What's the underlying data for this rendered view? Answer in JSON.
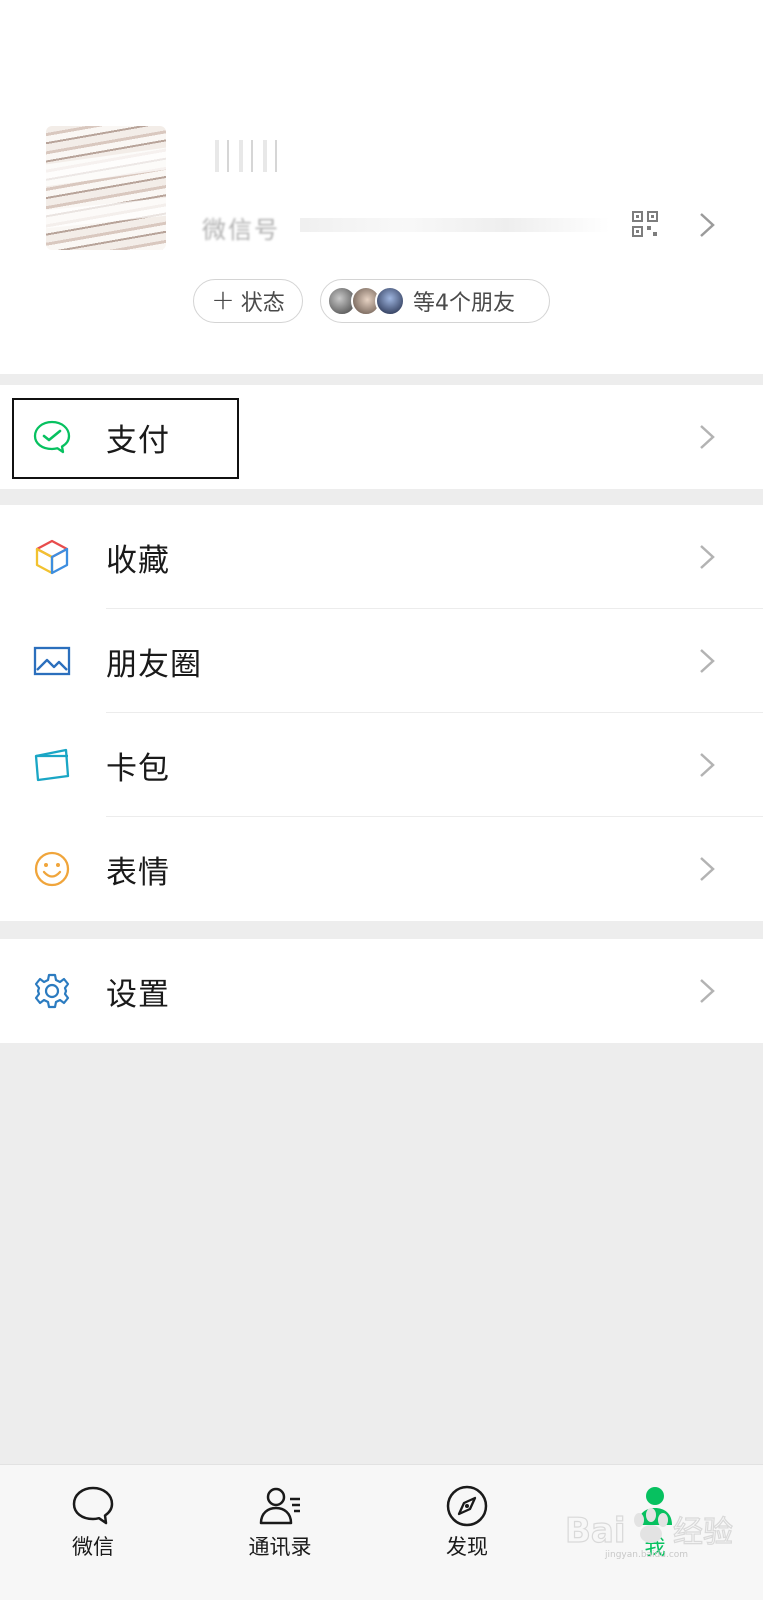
{
  "profile": {
    "wechat_id_label": "微信号",
    "status_label": "状态",
    "status_plus": "+",
    "friends_label": "等4个朋友"
  },
  "menu": {
    "pay": "支付",
    "favorites": "收藏",
    "moments": "朋友圈",
    "cards": "卡包",
    "stickers": "表情",
    "settings": "设置"
  },
  "tabbar": {
    "chats": "微信",
    "contacts": "通讯录",
    "discover": "发现",
    "me": "我"
  },
  "watermark": {
    "text": "jingyan.baidu.com"
  },
  "colors": {
    "accent_green": "#07c160",
    "background": "#ededed",
    "pay_icon": "#07c160",
    "moments_icon": "#2b6fbd",
    "cards_icon": "#1aa6c5",
    "stickers_icon": "#f0a53b",
    "settings_icon": "#2b7bc0"
  },
  "icons": {
    "pay": "wechat-pay-icon",
    "favorites": "cube-icon",
    "moments": "image-icon",
    "cards": "card-icon",
    "stickers": "smiley-icon",
    "settings": "gear-icon",
    "qr": "qr-code-icon",
    "chats": "chat-bubble-icon",
    "contacts": "contacts-icon",
    "discover": "compass-icon",
    "me": "person-icon"
  }
}
